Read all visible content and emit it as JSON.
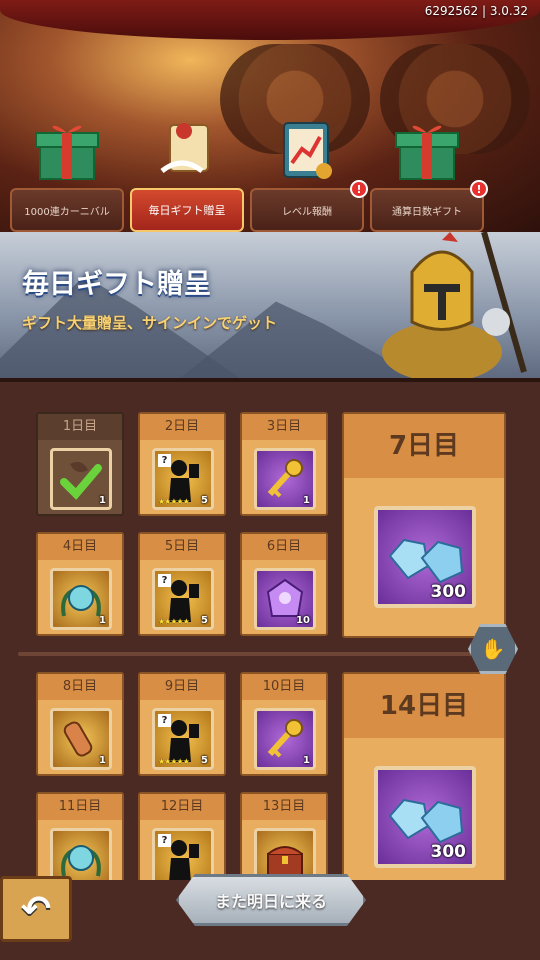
{
  "version_label": "6292562 | 3.0.32",
  "tabs": [
    {
      "label": "1000連カーニバル",
      "badge": ""
    },
    {
      "label": "毎日ギフト贈呈",
      "badge": ""
    },
    {
      "label": "レベル報酬",
      "badge": "!"
    },
    {
      "label": "通算日数ギフト",
      "badge": "!"
    }
  ],
  "header": {
    "title": "毎日ギフト贈呈",
    "subtitle": "ギフト大量贈呈、サインインでゲット"
  },
  "week1": {
    "days": [
      {
        "day": "1日目",
        "qty": "1",
        "claimed": true,
        "icon": "material-check-icon"
      },
      {
        "day": "2日目",
        "qty": "5",
        "stars": "★★★★★",
        "mystery": "?",
        "icon": "hero-shard-icon"
      },
      {
        "day": "3日目",
        "qty": "1",
        "icon": "gold-key-icon"
      },
      {
        "day": "4日目",
        "qty": "1",
        "icon": "orb-icon"
      },
      {
        "day": "5日目",
        "qty": "5",
        "stars": "★★★★★",
        "mystery": "?",
        "icon": "hero-shard-icon"
      },
      {
        "day": "6日目",
        "qty": "10",
        "icon": "purple-crystal-icon"
      }
    ],
    "big": {
      "day": "7日目",
      "qty": "300",
      "icon": "diamond-icon"
    }
  },
  "week2": {
    "days": [
      {
        "day": "8日目",
        "qty": "1",
        "icon": "scroll-icon"
      },
      {
        "day": "9日目",
        "qty": "5",
        "stars": "★★★★★",
        "mystery": "?",
        "icon": "hero-shard-icon"
      },
      {
        "day": "10日目",
        "qty": "1",
        "icon": "gold-key-icon"
      },
      {
        "day": "11日目",
        "qty": "",
        "icon": "orb-icon"
      },
      {
        "day": "12日目",
        "qty": "",
        "mystery": "?",
        "icon": "hero-shard-icon"
      },
      {
        "day": "13日目",
        "qty": "",
        "icon": "treasure-chest-icon"
      }
    ],
    "big": {
      "day": "14日目",
      "qty": "300",
      "icon": "diamond-icon"
    }
  },
  "buttons": {
    "come_tomorrow": "また明日に来る",
    "back_icon": "↶"
  },
  "colors": {
    "cell_bg": "#e8ad5e",
    "panel_bg": "#4a2a22",
    "accent_tab": "#d34a2e"
  }
}
